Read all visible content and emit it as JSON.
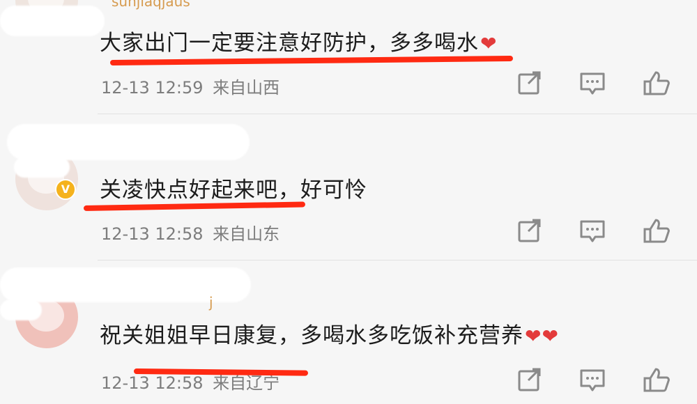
{
  "comments": [
    {
      "username_fragment": "sunjiaqjaus",
      "text": "大家出门一定要注意好防护，多多喝水",
      "hearts": "❤",
      "time": "12-13 12:59",
      "location": "来自山西",
      "verified": false
    },
    {
      "username_fragment": "",
      "text": "关凌快点好起来吧，好可怜",
      "hearts": "",
      "time": "12-13 12:58",
      "location": "来自山东",
      "verified": true
    },
    {
      "username_fragment": "j",
      "text": "祝关姐姐早日康复，多喝水多吃饭补充营养",
      "hearts": "❤❤",
      "time": "12-13 12:58",
      "location": "来自辽宁",
      "verified": false
    }
  ],
  "icons": {
    "share": "share-icon",
    "comment": "comment-icon",
    "like": "like-icon"
  },
  "colors": {
    "background": "#f6f6f6",
    "underline": "#ff2a12",
    "heart": "#e33b3b",
    "verified_badge": "#f5b21d"
  }
}
